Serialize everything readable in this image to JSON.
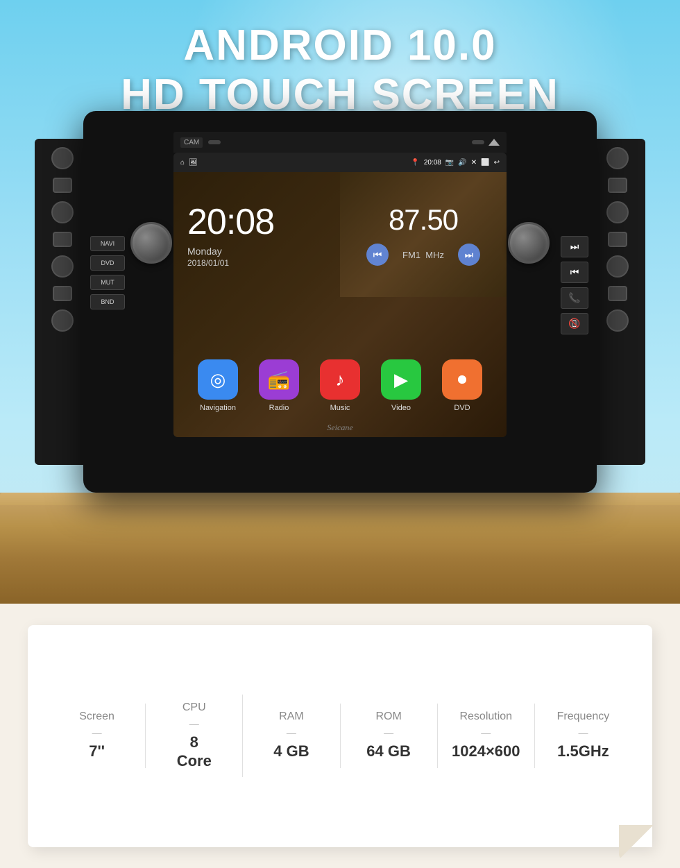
{
  "hero": {
    "title_line1": "ANDROID 10.0",
    "title_line2": "HD TOUCH SCREEN"
  },
  "screen": {
    "time": "20:08",
    "day": "Monday",
    "date": "2018/01/01",
    "frequency": "87.50",
    "radio_band": "FM1",
    "radio_unit": "MHz",
    "status_time": "20:08",
    "watermark": "Seicane"
  },
  "buttons": {
    "navi": "NAVI",
    "dvd": "DVD",
    "mut": "MUT",
    "bnd": "BND"
  },
  "apps": [
    {
      "label": "Navigation",
      "color": "app-nav",
      "icon": "◎"
    },
    {
      "label": "Radio",
      "color": "app-radio",
      "icon": "📻"
    },
    {
      "label": "Music",
      "color": "app-music",
      "icon": "♪"
    },
    {
      "label": "Video",
      "color": "app-video",
      "icon": "▶"
    },
    {
      "label": "DVD",
      "color": "app-dvd",
      "icon": "⏺"
    }
  ],
  "specs": [
    {
      "label": "Screen",
      "value": "7''"
    },
    {
      "label": "CPU",
      "value": "8\nCore"
    },
    {
      "label": "RAM",
      "value": "4 GB"
    },
    {
      "label": "ROM",
      "value": "64 GB"
    },
    {
      "label": "Resolution",
      "value": "1024×600"
    },
    {
      "label": "Frequency",
      "value": "1.5GHz"
    }
  ]
}
